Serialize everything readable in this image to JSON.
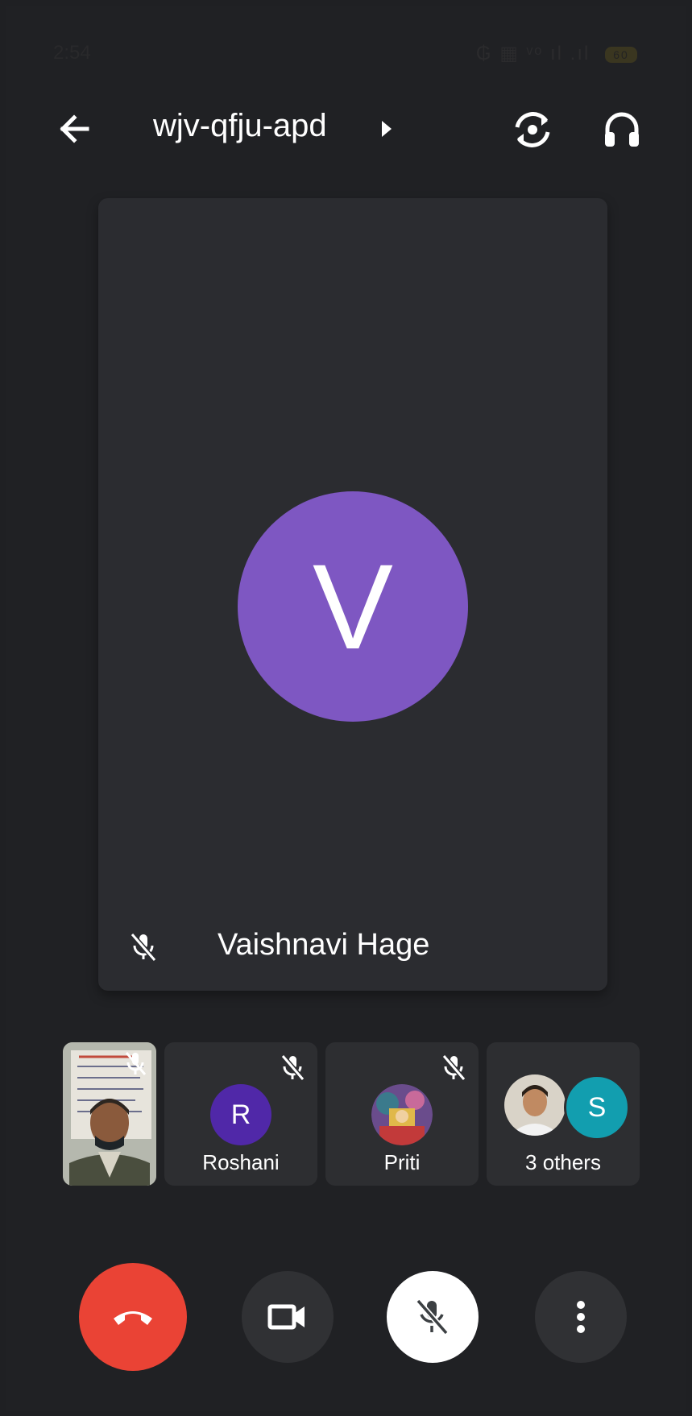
{
  "status_bar": {
    "time": "2:54",
    "right_indicators": "₲ ▦ ᵛᵒ ıl .ıl",
    "battery": "60"
  },
  "header": {
    "meeting_code": "wjv-qfju-apd",
    "back_icon": "arrow-left-icon",
    "flip_camera_icon": "flip-camera-icon",
    "audio_output_icon": "headphones-icon"
  },
  "main_speaker": {
    "initial": "V",
    "name": "Vaishnavi Hage",
    "avatar_color": "#7e57c2",
    "muted": true
  },
  "participants": [
    {
      "label": "Roshani",
      "initial": "R",
      "avatar_color": "#5028a8",
      "muted": true
    },
    {
      "label": "Priti",
      "initial": "",
      "avatar_color": "#8a5a9a",
      "muted": true
    },
    {
      "label": "3 others",
      "initial": "S",
      "avatar_color": "#129eaf",
      "muted": false
    }
  ],
  "controls": {
    "end_call_color": "#ea4335",
    "end_call_icon": "phone-hangup-icon",
    "camera_icon": "video-camera-icon",
    "mic_icon": "mic-off-icon",
    "more_icon": "more-vertical-icon"
  }
}
